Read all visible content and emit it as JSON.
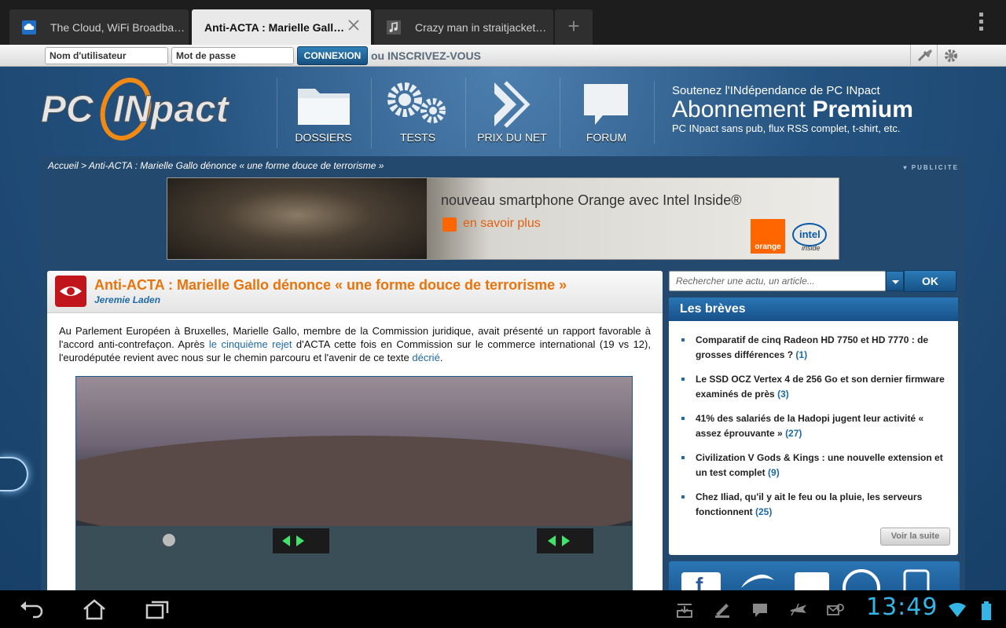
{
  "browser": {
    "tabs": [
      {
        "title": "The Cloud, WiFi Broadba…",
        "active": false
      },
      {
        "title": "Anti-ACTA : Marielle Gall…",
        "active": true
      },
      {
        "title": "Crazy man in straitjacket…",
        "active": false
      }
    ],
    "new_tab_label": "+"
  },
  "login": {
    "username_placeholder": "Nom d'utilisateur",
    "password_placeholder": "Mot de passe",
    "login_button": "CONNEXION",
    "register_link": "ou INSCRIVEZ-VOUS"
  },
  "site": {
    "logo_text_pc": "PC",
    "logo_text_inpact": "INpact",
    "nav": [
      "DOSSIERS",
      "TESTS",
      "PRIX DU NET",
      "FORUM"
    ],
    "premium": {
      "line1": "Soutenez l'INdépendance de PC INpact",
      "line2_a": "Abonnement",
      "line2_b": "Premium",
      "line3": "PC INpact sans pub, flux RSS complet, t-shirt, etc."
    },
    "breadcrumb": "Accueil > Anti-ACTA : Marielle Gallo dénonce « une forme douce de terrorisme »",
    "pub_label": "PUBLICITE"
  },
  "ad": {
    "headline": "nouveau smartphone Orange avec Intel Inside®",
    "cta": "en savoir plus",
    "brand_orange": "orange",
    "brand_intel": "intel",
    "brand_intel_sub": "inside"
  },
  "article": {
    "title": "Anti-ACTA : Marielle Gallo dénonce « une forme douce de terrorisme »",
    "author": "Jeremie Laden",
    "body_part1": "Au Parlement Européen à Bruxelles, Marielle Gallo, membre de la Commission juridique, avait présenté un rapport favorable à l'accord anti-contrefaçon. Après ",
    "body_link1": "le cinquième rejet",
    "body_part2": " d'ACTA cette fois en Commission sur le commerce international (19 vs 12), l'eurodéputée revient avec nous sur le chemin parcouru et l'avenir de ce texte ",
    "body_link2": "décrié",
    "body_part3": "."
  },
  "search": {
    "placeholder": "Rechercher une actu, un article...",
    "ok_label": "OK"
  },
  "breves": {
    "title": "Les brèves",
    "items": [
      {
        "text": "Comparatif de cinq Radeon HD 7750 et HD 7770 : de grosses différences ?",
        "count": "(1)"
      },
      {
        "text": "Le SSD OCZ Vertex 4 de 256 Go et son dernier firmware examinés de près",
        "count": "(3)"
      },
      {
        "text": "41% des salariés de la Hadopi jugent leur activité « assez éprouvante »",
        "count": "(27)"
      },
      {
        "text": "Civilization V Gods & Kings : une nouvelle extension et un test complet",
        "count": "(9)"
      },
      {
        "text": "Chez Iliad, qu'il y ait le feu ou la pluie, les serveurs fonctionnent",
        "count": "(25)"
      }
    ],
    "more_label": "Voir la suite"
  },
  "system": {
    "clock": "13:49"
  },
  "colors": {
    "accent_orange": "#e8740c",
    "link_blue": "#1e6aa6",
    "clock_blue": "#33b5e5"
  }
}
